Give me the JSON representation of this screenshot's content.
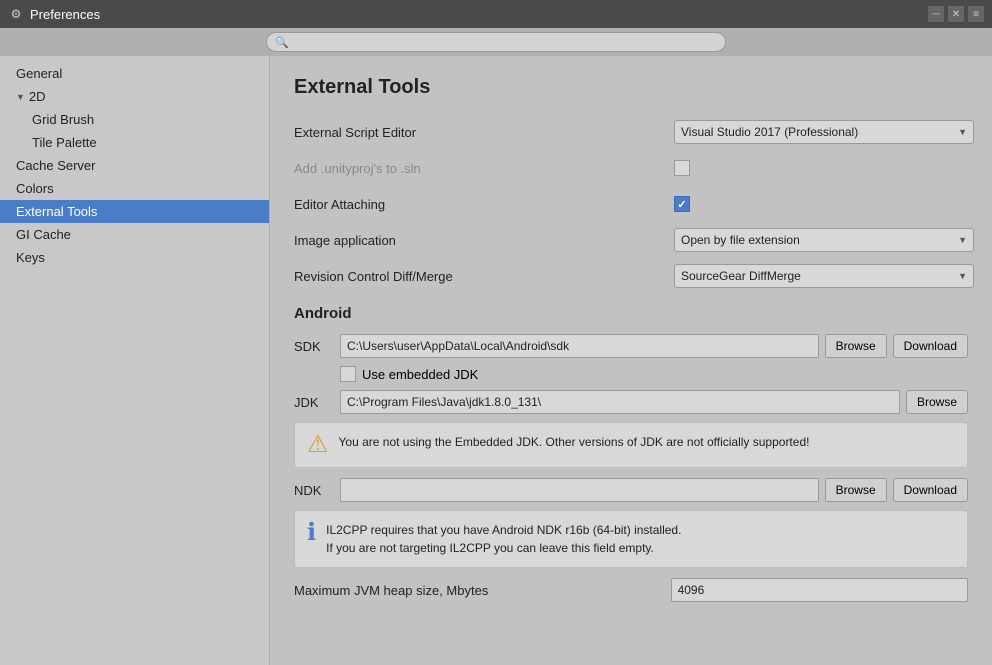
{
  "window": {
    "title": "Preferences",
    "icon": "⚙"
  },
  "search": {
    "placeholder": ""
  },
  "sidebar": {
    "items": [
      {
        "id": "general",
        "label": "General",
        "indent": "none",
        "active": false
      },
      {
        "id": "2d",
        "label": "2D",
        "indent": "none",
        "active": false,
        "group": true,
        "hasArrow": true
      },
      {
        "id": "grid-brush",
        "label": "Grid Brush",
        "indent": "sub",
        "active": false
      },
      {
        "id": "tile-palette",
        "label": "Tile Palette",
        "indent": "sub",
        "active": false
      },
      {
        "id": "cache-server",
        "label": "Cache Server",
        "indent": "none",
        "active": false
      },
      {
        "id": "colors",
        "label": "Colors",
        "indent": "none",
        "active": false
      },
      {
        "id": "external-tools",
        "label": "External Tools",
        "indent": "none",
        "active": true
      },
      {
        "id": "gi-cache",
        "label": "GI Cache",
        "indent": "none",
        "active": false
      },
      {
        "id": "keys",
        "label": "Keys",
        "indent": "none",
        "active": false
      }
    ]
  },
  "content": {
    "pageTitle": "External Tools",
    "settings": {
      "externalScriptEditor": {
        "label": "External Script Editor",
        "value": "Visual Studio 2017 (Professional)"
      },
      "addUnityproj": {
        "label": "Add .unityproj's to .sln",
        "checked": false
      },
      "editorAttaching": {
        "label": "Editor Attaching",
        "checked": true
      },
      "imageApplication": {
        "label": "Image application",
        "value": "Open by file extension"
      },
      "revisionControl": {
        "label": "Revision Control Diff/Merge",
        "value": "SourceGear DiffMerge"
      }
    },
    "android": {
      "sectionTitle": "Android",
      "sdk": {
        "label": "SDK",
        "path": "C:\\Users\\user\\AppData\\Local\\Android\\sdk",
        "browseLabel": "Browse",
        "downloadLabel": "Download"
      },
      "embeddedJdk": {
        "label": "Use embedded JDK",
        "checked": false
      },
      "jdk": {
        "label": "JDK",
        "path": "C:\\Program Files\\Java\\jdk1.8.0_131\\",
        "browseLabel": "Browse"
      },
      "jdkWarning": "You are not using the Embedded JDK. Other versions of JDK are not officially supported!",
      "ndk": {
        "label": "NDK",
        "path": "",
        "browseLabel": "Browse",
        "downloadLabel": "Download"
      },
      "ndkInfo": "IL2CPP requires that you have Android NDK r16b (64-bit) installed.\nIf you are not targeting IL2CPP you can leave this field empty.",
      "maxHeap": {
        "label": "Maximum JVM heap size, Mbytes",
        "value": "4096"
      }
    }
  }
}
